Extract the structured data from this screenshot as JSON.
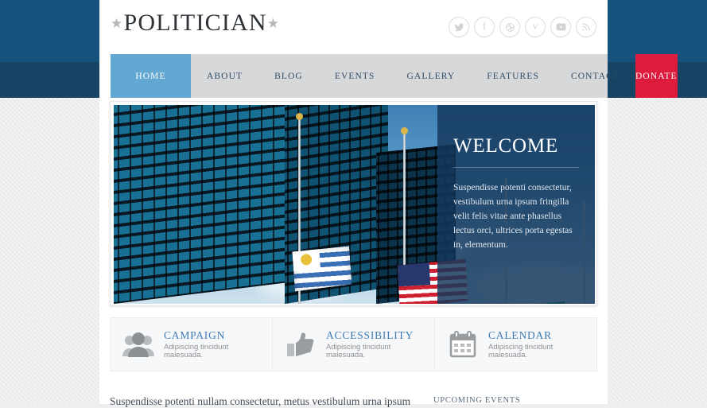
{
  "site": {
    "logo_text": "POLITICIAN",
    "logo_star_left": "★",
    "logo_star_right": "★"
  },
  "social": {
    "items": [
      {
        "name": "twitter-icon",
        "label": "Twitter"
      },
      {
        "name": "facebook-icon",
        "label": "f"
      },
      {
        "name": "dribbble-icon",
        "label": "Dribbble"
      },
      {
        "name": "vimeo-icon",
        "label": "v"
      },
      {
        "name": "youtube-icon",
        "label": "YouTube"
      },
      {
        "name": "rss-icon",
        "label": "RSS"
      }
    ]
  },
  "nav": {
    "items": [
      {
        "label": "HOME",
        "active": true
      },
      {
        "label": "ABOUT",
        "active": false
      },
      {
        "label": "BLOG",
        "active": false
      },
      {
        "label": "EVENTS",
        "active": false
      },
      {
        "label": "GALLERY",
        "active": false
      },
      {
        "label": "FEATURES",
        "active": false
      },
      {
        "label": "CONTACT",
        "active": false
      }
    ],
    "donate_label": "DONATE",
    "active_bg": "#62a8d2",
    "bar_bg": "#d7d8d9",
    "donate_bg": "#dd1b3c"
  },
  "hero": {
    "title": "WELCOME",
    "body": "Suspendisse potenti consectetur, vestibulum urna ipsum fringilla velit felis vitae ante phasellus lectus orci, ultrices porta egestas in, elementum.",
    "panel_color": "#14385c",
    "image_alt": "Flags of Uruguay, United States, Tanzania and United Kingdom in front of a glass office tower"
  },
  "features": [
    {
      "icon": "people-group-icon",
      "title": "CAMPAIGN",
      "subtitle": "Adipiscing tincidunt malesuada."
    },
    {
      "icon": "thumbs-up-icon",
      "title": "ACCESSIBILITY",
      "subtitle": "Adipiscing tincidunt malesuada."
    },
    {
      "icon": "calendar-icon",
      "title": "CALENDAR",
      "subtitle": "Adipiscing tincidunt malesuada."
    }
  ],
  "bottom": {
    "intro_text": "Suspendisse potenti nullam consectetur, metus vestibulum urna ipsum",
    "sidebar_heading": "UPCOMING EVENTS"
  },
  "colors": {
    "header_band": "#15527d",
    "header_band_lower": "#174464",
    "page_bg": "#ededed",
    "link_blue": "#3d7ab5"
  }
}
